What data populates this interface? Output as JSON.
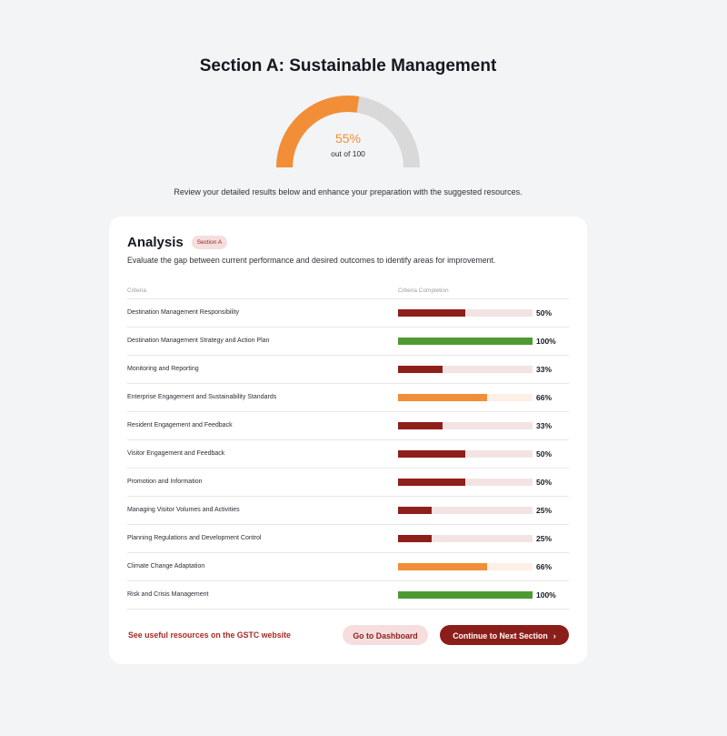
{
  "page": {
    "title": "Section A: Sustainable Management",
    "intro": "Review your detailed results below and enhance your preparation with the suggested resources."
  },
  "gauge": {
    "score_label": "55%",
    "score_value": 55,
    "subtitle": "out of 100",
    "fill_color": "#f28e37",
    "track_color": "#d9d9d9"
  },
  "analysis": {
    "title": "Analysis",
    "badge": "Section A",
    "description": "Evaluate the gap between current performance and desired outcomes to identify areas for improvement.",
    "columns": [
      "Criteria",
      "Criteria Completion"
    ],
    "rows": [
      {
        "criteria": "Destination Management Responsibility",
        "percent": 50,
        "label": "50%",
        "level": "low"
      },
      {
        "criteria": "Destination Management Strategy and Action Plan",
        "percent": 100,
        "label": "100%",
        "level": "high"
      },
      {
        "criteria": "Monitoring and Reporting",
        "percent": 33,
        "label": "33%",
        "level": "low"
      },
      {
        "criteria": "Enterprise Engagement and Sustainability Standards",
        "percent": 66,
        "label": "66%",
        "level": "mid"
      },
      {
        "criteria": "Resident Engagement and Feedback",
        "percent": 33,
        "label": "33%",
        "level": "low"
      },
      {
        "criteria": "Visitor Engagement and Feedback",
        "percent": 50,
        "label": "50%",
        "level": "low"
      },
      {
        "criteria": "Promotion and Information",
        "percent": 50,
        "label": "50%",
        "level": "low"
      },
      {
        "criteria": "Managing Visitor Volumes and Activities",
        "percent": 25,
        "label": "25%",
        "level": "low"
      },
      {
        "criteria": "Planning Regulations and Development Control",
        "percent": 25,
        "label": "25%",
        "level": "low"
      },
      {
        "criteria": "Climate Change Adaptation",
        "percent": 66,
        "label": "66%",
        "level": "mid"
      },
      {
        "criteria": "Risk and Crisis Management",
        "percent": 100,
        "label": "100%",
        "level": "high"
      }
    ],
    "level_colors": {
      "low": {
        "fill": "#8f1f1a",
        "track": "#f3e4e3"
      },
      "mid": {
        "fill": "#f28e37",
        "track": "#fdf0e6"
      },
      "high": {
        "fill": "#4e9a32",
        "track": "#e8f3e4"
      }
    }
  },
  "footer": {
    "resources_link": "See useful resources on the GSTC website",
    "dashboard_button": "Go to Dashboard",
    "next_button": "Continue to Next Section",
    "next_icon": "chevron-right-icon"
  }
}
